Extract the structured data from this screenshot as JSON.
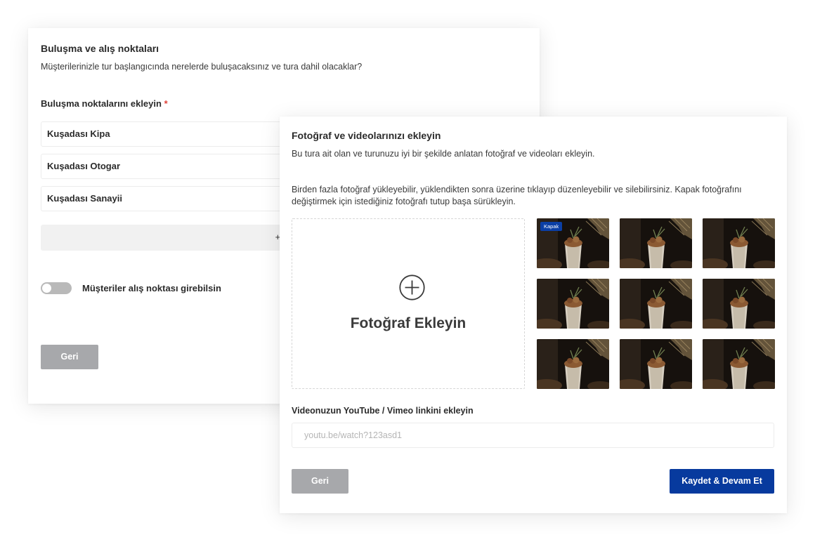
{
  "meeting": {
    "title": "Buluşma ve alış noktaları",
    "subtitle": "Müşterilerinizle tur başlangıcında nerelerde buluşacaksınız ve tura dahil olacaklar?",
    "field_label": "Buluşma noktalarını ekleyin",
    "required_mark": "*",
    "locations": [
      "Kuşadası Kipa",
      "Kuşadası Otogar",
      "Kuşadası Sanayii"
    ],
    "add_label": "+ Ye",
    "toggle_label": "Müşteriler alış noktası girebilsin",
    "toggle_on": false,
    "back_label": "Geri"
  },
  "media": {
    "title": "Fotoğraf ve videolarınızı ekleyin",
    "subtitle": "Bu tura ait olan ve turunuzu iyi bir şekilde anlatan fotoğraf ve videoları ekleyin.",
    "helper": "Birden fazla fotoğraf yükleyebilir, yüklendikten sonra üzerine tıklayıp düzenleyebilir ve silebilirsiniz. Kapak fotoğrafını değiştirmek için istediğiniz fotoğrafı tutup başa sürükleyin.",
    "dropzone_label": "Fotoğraf Ekleyin",
    "dropzone_icon": "plus-circle-icon",
    "cover_badge": "Kapak",
    "photo_count": 9,
    "video_label": "Videonuzun YouTube / Vimeo linkini ekleyin",
    "video_placeholder": "youtu.be/watch?123asd1",
    "video_value": "",
    "back_label": "Geri",
    "save_label": "Kaydet & Devam Et"
  },
  "colors": {
    "primary": "#073a9e",
    "badge": "#0b3fa5",
    "grey_button": "#a7a8ab",
    "required": "#e0433a",
    "toggle_off": "#b9b9b9"
  }
}
